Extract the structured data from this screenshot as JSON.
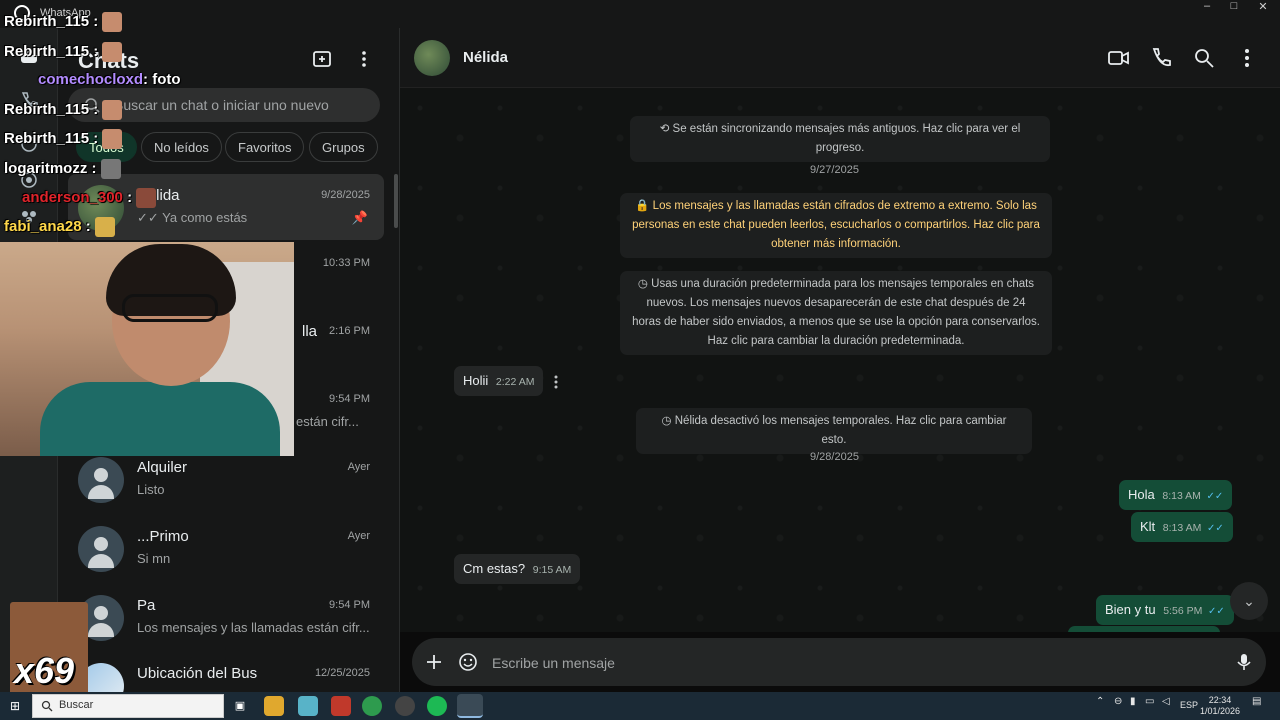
{
  "titlebar": {
    "app_name": "WhatsApp",
    "minimize": "–",
    "maximize": "□",
    "close": "✕"
  },
  "sidebar": {
    "title": "Chats",
    "search_placeholder": "Buscar un chat o iniciar uno nuevo",
    "filters": [
      "Todos",
      "No leídos",
      "Favoritos",
      "Grupos"
    ],
    "chats": [
      {
        "name": "Nélida",
        "time": "9/28/2025",
        "last": "✓✓ Ya como estás",
        "pinned": "📌"
      },
      {
        "name": "",
        "time": "10:33 PM",
        "last": ""
      },
      {
        "name": "lla",
        "time": "2:16 PM",
        "last": ""
      },
      {
        "name": "",
        "time": "9:54 PM",
        "last": "están cifr..."
      },
      {
        "name": "Alquiler",
        "time": "Ayer",
        "last": "Listo"
      },
      {
        "name": "...Primo",
        "time": "Ayer",
        "last": "Si mn"
      },
      {
        "name": "Pa",
        "time": "9:54 PM",
        "last": "Los mensajes y las llamadas están cifr..."
      },
      {
        "name": "Ubicación del Bus",
        "time": "12/25/2025",
        "last": ""
      }
    ]
  },
  "conversation": {
    "contact_name": "Nélida",
    "sync_notice": "⟲ Se están sincronizando mensajes más antiguos. Haz clic para ver el progreso.",
    "date1": "9/27/2025",
    "encryption_notice": "🔒 Los mensajes y las llamadas están cifrados de extremo a extremo. Solo las personas en este chat pueden leerlos, escucharlos o compartirlos. Haz clic para obtener más información.",
    "temporary_notice": "◷ Usas una duración predeterminada para los mensajes temporales en chats nuevos. Los mensajes nuevos desaparecerán de este chat después de 24 horas de haber sido enviados, a menos que se use la opción para conservarlos. Haz clic para cambiar la duración predeterminada.",
    "disabled_notice": "◷ Nélida desactivó los mensajes temporales. Haz clic para cambiar esto.",
    "date2": "9/28/2025",
    "messages": [
      {
        "dir": "in",
        "text": "Holii",
        "time": "2:22 AM"
      },
      {
        "dir": "out",
        "text": "Hola",
        "time": "8:13 AM",
        "ticks": "✓✓"
      },
      {
        "dir": "out",
        "text": "Klt",
        "time": "8:13 AM",
        "ticks": "✓✓"
      },
      {
        "dir": "in",
        "text": "Cm estas?",
        "time": "9:15 AM"
      },
      {
        "dir": "out",
        "text": "Bien y tu",
        "time": "5:56 PM",
        "ticks": "✓✓"
      }
    ],
    "composer_placeholder": "Escribe un mensaje"
  },
  "taskbar": {
    "search_label": "Buscar",
    "tray_lang": "ESP",
    "time": "22:34",
    "date": "1/01/2026"
  },
  "stream_overlay": {
    "lines": [
      {
        "user": "Rebirth_115",
        "text": ":",
        "color": "#ffffff"
      },
      {
        "user": "Rebirth_115",
        "text": ":",
        "color": "#ffffff"
      },
      {
        "user": "comechocloxd",
        "text": ": foto",
        "color": "#b38cff"
      },
      {
        "user": "Rebirth_115",
        "text": ":",
        "color": "#ffffff"
      },
      {
        "user": "Rebirth_115",
        "text": ":",
        "color": "#ffffff"
      },
      {
        "user": "logaritmozz",
        "text": ":",
        "color": "#ffffff"
      },
      {
        "user": "anderson_300",
        "text": ":",
        "color": "#e0242b"
      },
      {
        "user": "fabi_ana28",
        "text": ":",
        "color": "#ffd84a"
      }
    ],
    "cam_label": "x69"
  }
}
